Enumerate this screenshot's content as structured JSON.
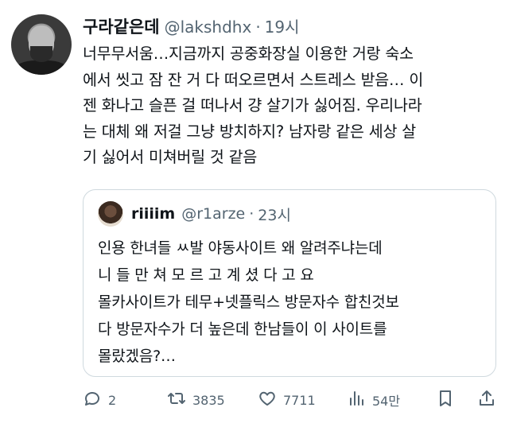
{
  "tweet": {
    "display_name": "구라같은데",
    "handle": "@lakshdhx",
    "separator": "·",
    "time": "19시",
    "text": "너무무서움…지금까지 공중화장실 이용한 거랑 숙소\n에서 씻고 잠 잔 거 다 떠오르면서 스트레스 받음… 이\n젠 화나고 슬픈 걸 떠나서 걍 살기가 싫어짐. 우리나라\n는 대체 왜 저걸 그냥 방치하지? 남자랑 같은 세상 살\n기 싫어서 미쳐버릴 것 같음"
  },
  "quote": {
    "display_name": "riiiim",
    "handle": "@r1arze",
    "separator": "·",
    "time": "23시",
    "text": "인용 한녀들 ㅆ발 야동사이트 왜 알려주냐는데\n니 들 만 쳐 모 르 고 계 셨 다 고 요\n몰카사이트가 테무+넷플릭스 방문자수 합친것보\n다 방문자수가 더 높은데 한남들이 이 사이트를\n몰랐겠음?…"
  },
  "actions": {
    "reply": {
      "icon": "reply-icon",
      "count": "2"
    },
    "retweet": {
      "icon": "retweet-icon",
      "count": "3835"
    },
    "like": {
      "icon": "heart-icon",
      "count": "7711"
    },
    "views": {
      "icon": "views-icon",
      "count": "54만"
    },
    "bookmark": {
      "icon": "bookmark-icon"
    },
    "share": {
      "icon": "share-icon"
    }
  },
  "colors": {
    "text": "#0f1419",
    "secondary": "#536471",
    "border": "#cfd9de",
    "background": "#ffffff"
  }
}
